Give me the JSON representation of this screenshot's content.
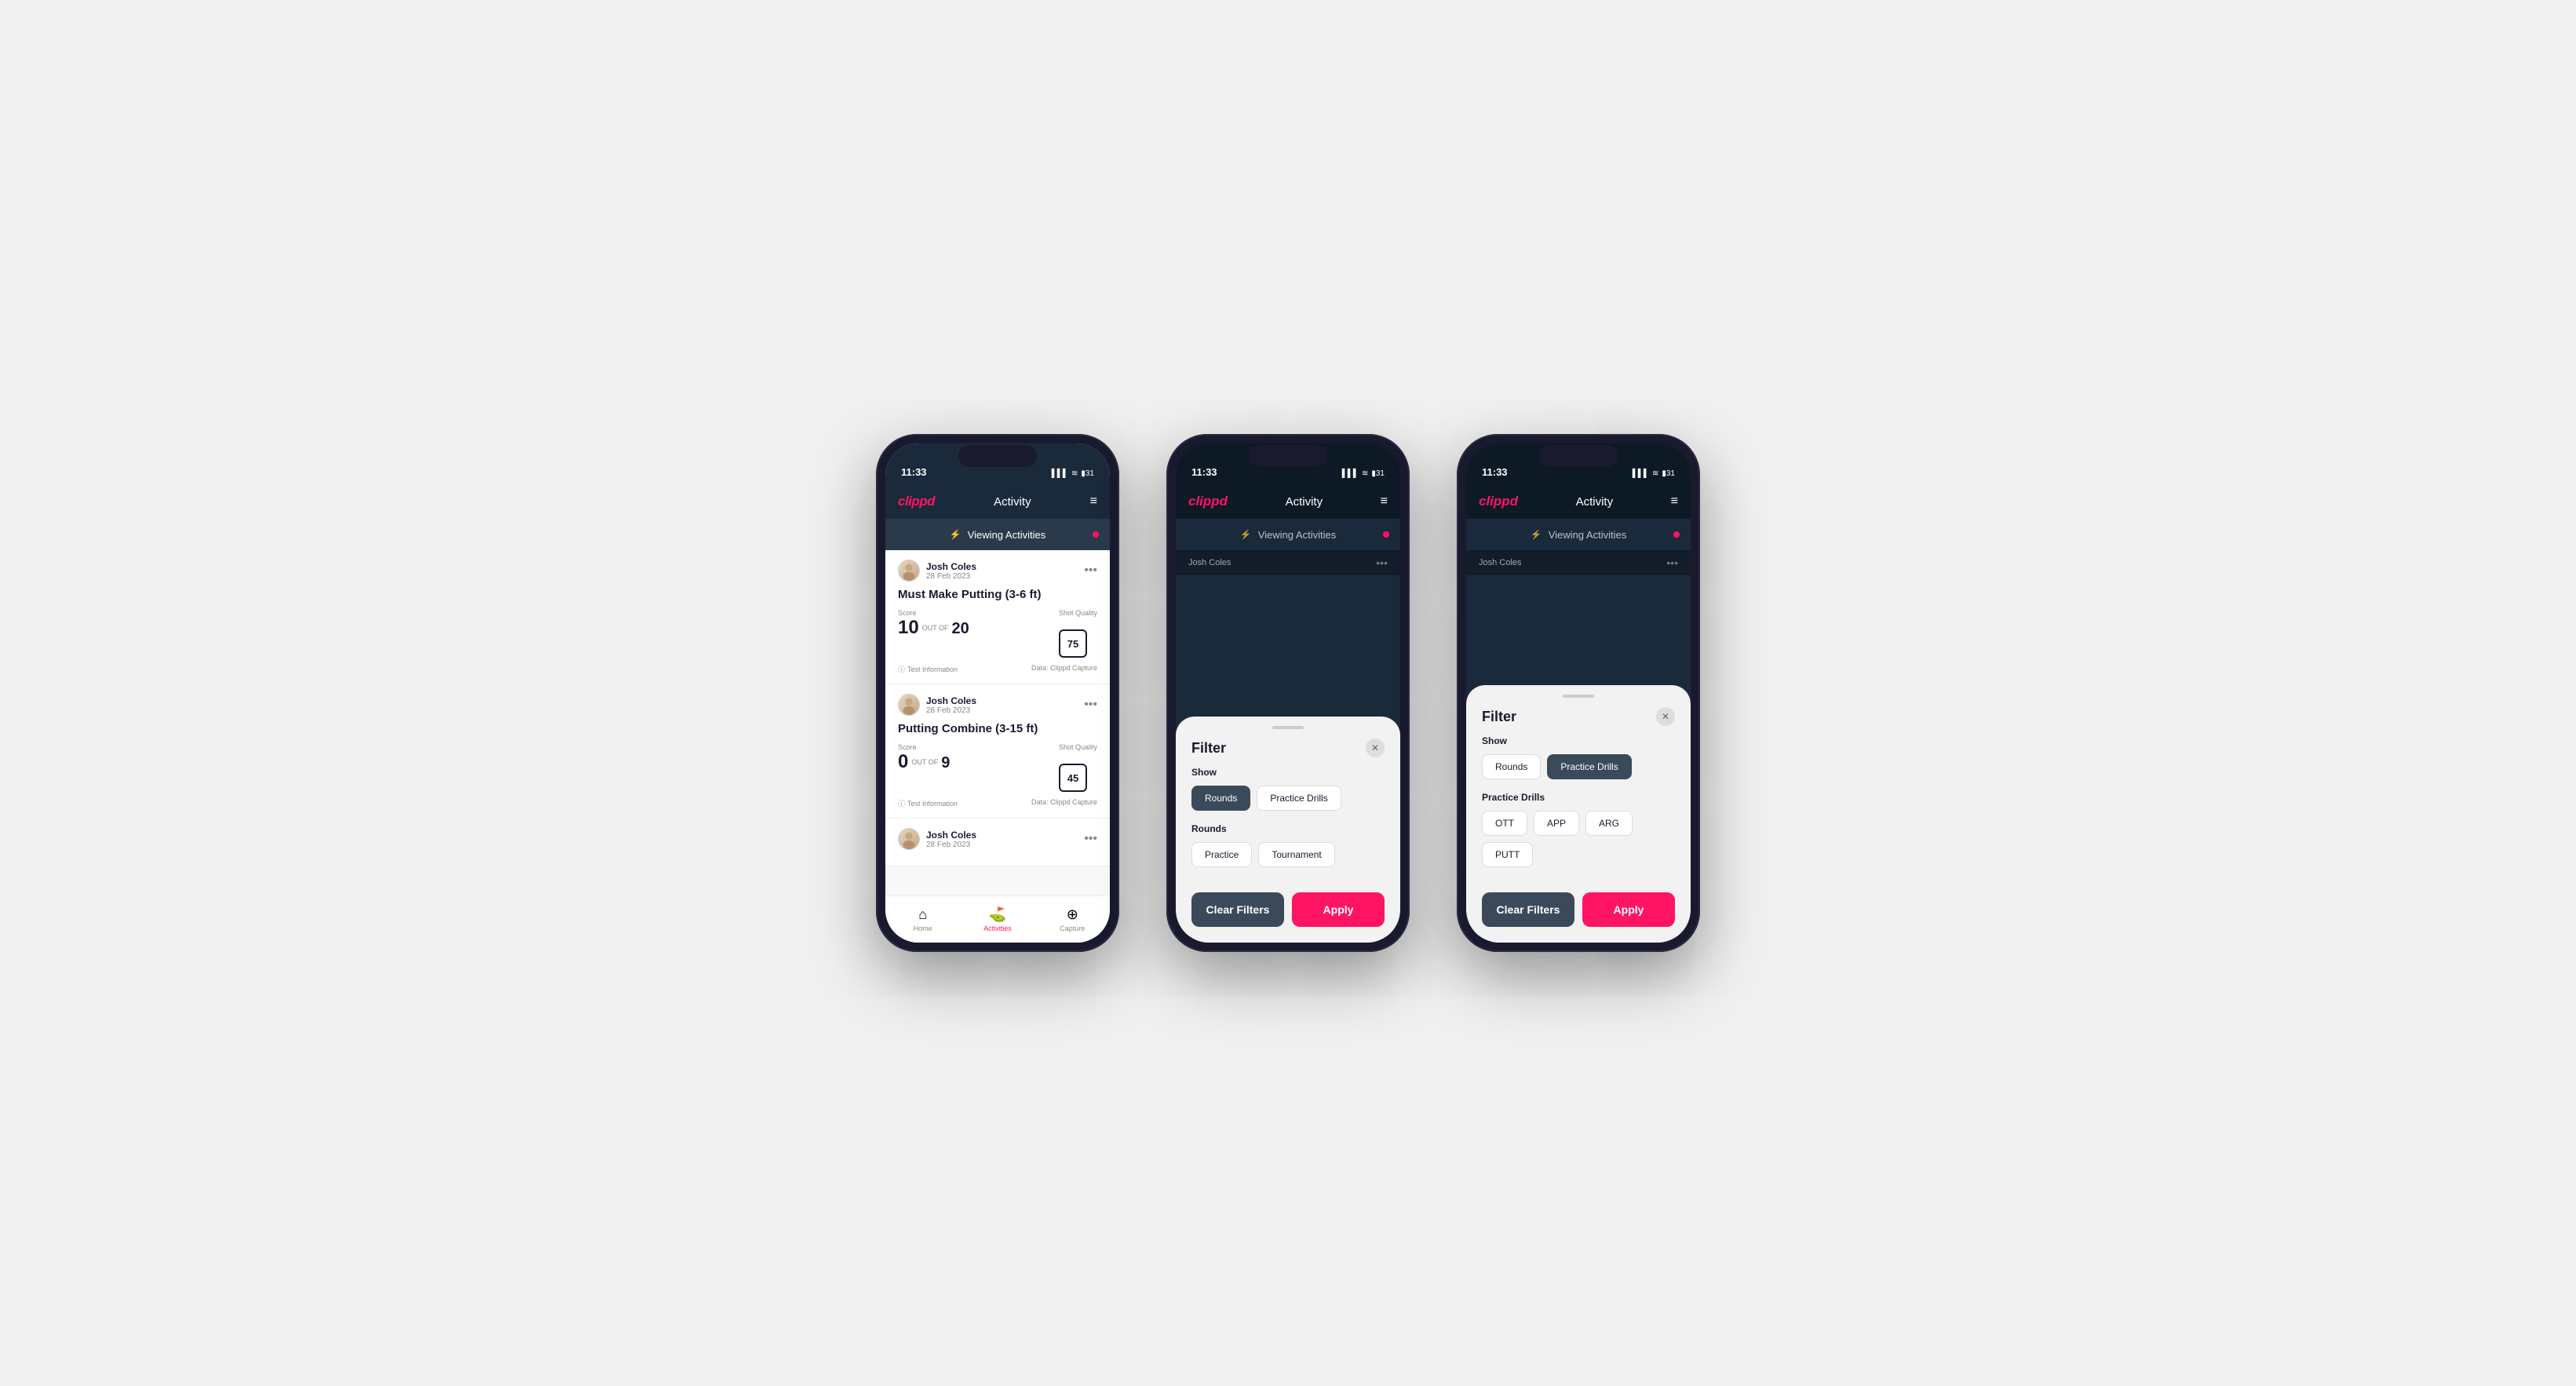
{
  "phones": [
    {
      "id": "phone1",
      "type": "activity-screen",
      "statusBar": {
        "time": "11:33",
        "icons": "▌▌▌ ≋ 31"
      },
      "nav": {
        "logo": "clippd",
        "title": "Activity",
        "menuIcon": "≡"
      },
      "viewingBanner": {
        "icon": "⚡",
        "text": "Viewing Activities"
      },
      "activities": [
        {
          "user": "Josh Coles",
          "date": "28 Feb 2023",
          "title": "Must Make Putting (3-6 ft)",
          "score": 10,
          "outOf": 20,
          "shotQuality": 75,
          "footer": "Test Information",
          "dataSource": "Data: Clippd Capture"
        },
        {
          "user": "Josh Coles",
          "date": "28 Feb 2023",
          "title": "Putting Combine (3-15 ft)",
          "score": 0,
          "outOf": 9,
          "shotQuality": 45,
          "footer": "Test Information",
          "dataSource": "Data: Clippd Capture"
        },
        {
          "user": "Josh Coles",
          "date": "28 Feb 2023",
          "title": "",
          "partial": true
        }
      ],
      "bottomTabs": [
        {
          "icon": "⌂",
          "label": "Home",
          "active": false
        },
        {
          "icon": "♟",
          "label": "Activities",
          "active": true
        },
        {
          "icon": "+",
          "label": "Capture",
          "active": false
        }
      ]
    },
    {
      "id": "phone2",
      "type": "filter-rounds",
      "statusBar": {
        "time": "11:33"
      },
      "nav": {
        "logo": "clippd",
        "title": "Activity",
        "menuIcon": "≡"
      },
      "viewingBanner": {
        "icon": "⚡",
        "text": "Viewing Activities"
      },
      "filter": {
        "title": "Filter",
        "showLabel": "Show",
        "showButtons": [
          {
            "label": "Rounds",
            "active": true
          },
          {
            "label": "Practice Drills",
            "active": false
          }
        ],
        "roundsLabel": "Rounds",
        "roundButtons": [
          {
            "label": "Practice",
            "active": false
          },
          {
            "label": "Tournament",
            "active": false
          }
        ],
        "clearFilters": "Clear Filters",
        "apply": "Apply"
      }
    },
    {
      "id": "phone3",
      "type": "filter-practice",
      "statusBar": {
        "time": "11:33"
      },
      "nav": {
        "logo": "clippd",
        "title": "Activity",
        "menuIcon": "≡"
      },
      "viewingBanner": {
        "icon": "⚡",
        "text": "Viewing Activities"
      },
      "filter": {
        "title": "Filter",
        "showLabel": "Show",
        "showButtons": [
          {
            "label": "Rounds",
            "active": false
          },
          {
            "label": "Practice Drills",
            "active": true
          }
        ],
        "practiceLabel": "Practice Drills",
        "practiceButtons": [
          {
            "label": "OTT",
            "active": false
          },
          {
            "label": "APP",
            "active": false
          },
          {
            "label": "ARG",
            "active": false
          },
          {
            "label": "PUTT",
            "active": false
          }
        ],
        "clearFilters": "Clear Filters",
        "apply": "Apply"
      }
    }
  ]
}
